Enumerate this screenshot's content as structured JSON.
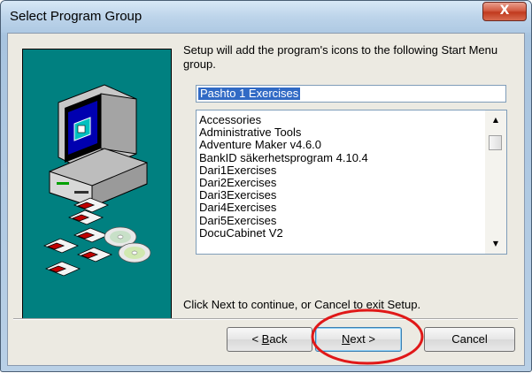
{
  "window": {
    "title": "Select Program Group",
    "close_glyph": "X"
  },
  "content": {
    "description": "Setup will add the program's icons to the following Start Menu group.",
    "group_name_value": "Pashto 1 Exercises",
    "groups": [
      "Accessories",
      "Administrative Tools",
      "Adventure Maker v4.6.0",
      "BankID säkerhetsprogram 4.10.4",
      "Dari1Exercises",
      "Dari2Exercises",
      "Dari3Exercises",
      "Dari4Exercises",
      "Dari5Exercises",
      "DocuCabinet V2"
    ],
    "footer_text": "Click Next to continue, or Cancel to exit Setup."
  },
  "buttons": {
    "back_pre": "< ",
    "back_key": "B",
    "back_post": "ack",
    "next_key": "N",
    "next_post": "ext >",
    "cancel": "Cancel"
  },
  "icons": {
    "close": "close-icon",
    "scroll_up": "scroll-up-arrow-icon",
    "scroll_down": "scroll-down-arrow-icon",
    "computer": "computer-icon",
    "floppy": "floppy-disk-icon",
    "cd": "cd-disc-icon"
  },
  "colors": {
    "art_background": "#008080",
    "selection": "#316ac5",
    "annotation_circle": "#e01818",
    "close_button": "#c13a1e"
  }
}
